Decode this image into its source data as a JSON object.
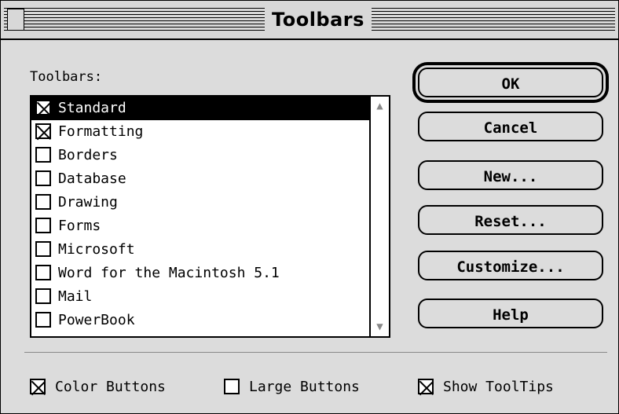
{
  "window": {
    "title": "Toolbars"
  },
  "list_label": "Toolbars:",
  "toolbars": [
    {
      "label": "Standard",
      "checked": true,
      "selected": true
    },
    {
      "label": "Formatting",
      "checked": true,
      "selected": false
    },
    {
      "label": "Borders",
      "checked": false,
      "selected": false
    },
    {
      "label": "Database",
      "checked": false,
      "selected": false
    },
    {
      "label": "Drawing",
      "checked": false,
      "selected": false
    },
    {
      "label": "Forms",
      "checked": false,
      "selected": false
    },
    {
      "label": "Microsoft",
      "checked": false,
      "selected": false
    },
    {
      "label": "Word for the Macintosh 5.1",
      "checked": false,
      "selected": false
    },
    {
      "label": "Mail",
      "checked": false,
      "selected": false
    },
    {
      "label": "PowerBook",
      "checked": false,
      "selected": false
    }
  ],
  "buttons": {
    "ok": "OK",
    "cancel": "Cancel",
    "new": "New...",
    "reset": "Reset...",
    "customize": "Customize...",
    "help": "Help"
  },
  "options": {
    "color_buttons": {
      "label": "Color Buttons",
      "checked": true
    },
    "large_buttons": {
      "label": "Large Buttons",
      "checked": false
    },
    "show_tooltips": {
      "label": "Show ToolTips",
      "checked": true
    }
  }
}
